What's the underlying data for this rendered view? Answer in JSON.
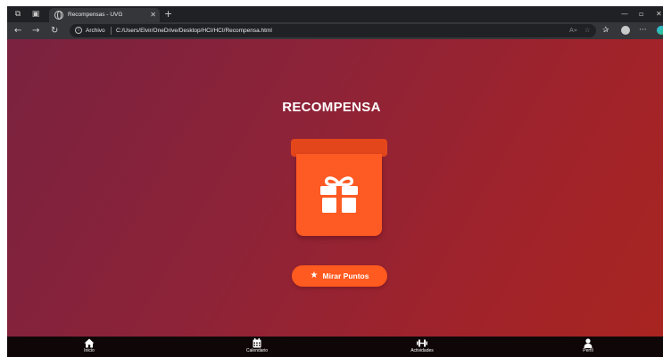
{
  "browser": {
    "tab_title": "Recompensas - UVG",
    "tab_close": "✕",
    "new_tab": "+",
    "address_scheme": "Archivo",
    "address_url": "C:/Users/Elvir/OneDrive/Desktop/HCI/HCI/Recompensa.html",
    "window_controls": [
      "—",
      "▫",
      "✕"
    ],
    "nav_icons": [
      "back-arrow-icon",
      "forward-arrow-icon",
      "reload-icon"
    ]
  },
  "page": {
    "title": "RECOMPENSA",
    "button_label": "Mirar Puntos",
    "accent_color": "#fd5a24",
    "lid_color": "#e4461b"
  },
  "bottom_nav": {
    "items": [
      {
        "label": "Inicio",
        "icon": "home-icon"
      },
      {
        "label": "Calendario",
        "icon": "calendar-icon"
      },
      {
        "label": "Actividades",
        "icon": "dumbbell-icon"
      },
      {
        "label": "Perfil",
        "icon": "user-icon"
      }
    ]
  }
}
